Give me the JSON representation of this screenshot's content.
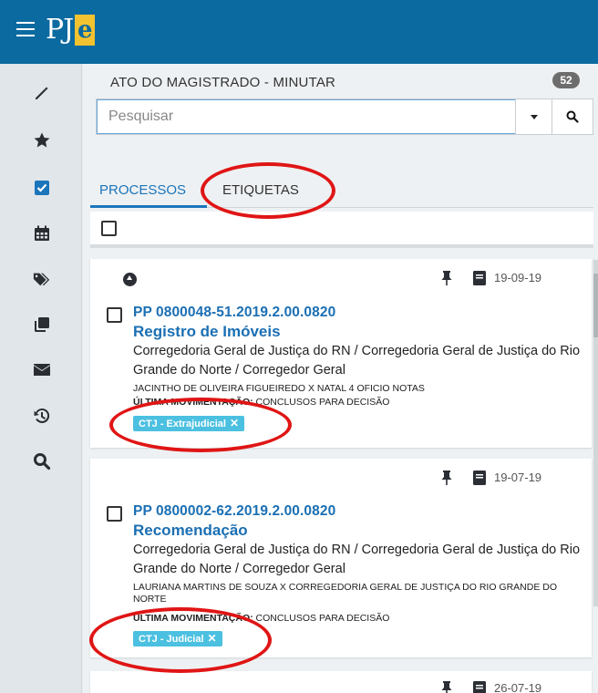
{
  "app": {
    "logo_text": "PJ",
    "logo_letter": "e"
  },
  "header": {
    "title": "ATO DO MAGISTRADO - MINUTAR",
    "count": "52"
  },
  "search": {
    "placeholder": "Pesquisar"
  },
  "tabs": [
    {
      "label": "PROCESSOS"
    },
    {
      "label": "ETIQUETAS"
    }
  ],
  "sidebar": [
    {
      "icon": "pencil-icon"
    },
    {
      "icon": "star-icon"
    },
    {
      "icon": "checkbox-icon"
    },
    {
      "icon": "calendar-icon"
    },
    {
      "icon": "tags-icon"
    },
    {
      "icon": "copy-icon"
    },
    {
      "icon": "envelope-icon"
    },
    {
      "icon": "history-icon"
    },
    {
      "icon": "search-icon"
    }
  ],
  "processes": [
    {
      "date": "19-09-19",
      "number": "PP 0800048-51.2019.2.00.0820",
      "class": "Registro de Imóveis",
      "organ": "Corregedoria Geral de Justiça do RN / Corregedoria Geral de Justiça do Rio Grande do Norte / Corregedor Geral",
      "parties": "JACINTHO DE OLIVEIRA FIGUEIREDO X NATAL 4 OFICIO NOTAS",
      "last_movement_label": "ÚLTIMA MOVIMENTAÇÃO:",
      "last_movement": "CONCLUSOS PARA DECISÃO",
      "tag": "CTJ - Extrajudicial"
    },
    {
      "date": "19-07-19",
      "number": "PP 0800002-62.2019.2.00.0820",
      "class": "Recomendação",
      "organ": "Corregedoria Geral de Justiça do RN / Corregedoria Geral de Justiça do Rio Grande do Norte / Corregedor Geral",
      "parties": "LAURIANA MARTINS DE SOUZA X CORREGEDORIA GERAL DE JUSTIÇA DO RIO GRANDE DO NORTE",
      "last_movement_label": "ÚLTIMA MOVIMENTAÇÃO:",
      "last_movement": "CONCLUSOS PARA DECISÃO",
      "tag": "CTJ - Judicial"
    },
    {
      "date": "26-07-19"
    }
  ],
  "colors": {
    "topbar": "#0b6aa0",
    "link": "#1b6fb3",
    "tag": "#4cc0e0",
    "annotation": "#e01515"
  }
}
